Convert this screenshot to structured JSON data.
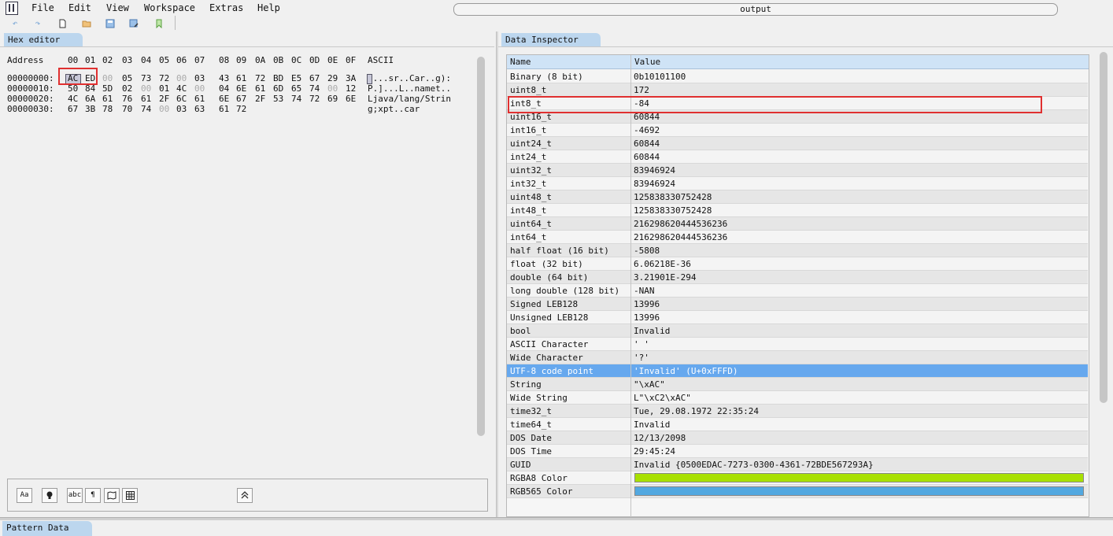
{
  "menu": {
    "items": [
      "File",
      "Edit",
      "View",
      "Workspace",
      "Extras",
      "Help"
    ],
    "output_label": "output"
  },
  "toolbar": {
    "icons": [
      "undo-icon",
      "redo-icon",
      "new-file-icon",
      "open-file-icon",
      "save-icon",
      "save-as-icon",
      "bookmark-icon"
    ]
  },
  "hex_editor": {
    "tab_label": "Hex editor",
    "header": {
      "address": "Address",
      "columns": [
        "00",
        "01",
        "02",
        "03",
        "04",
        "05",
        "06",
        "07",
        "08",
        "09",
        "0A",
        "0B",
        "0C",
        "0D",
        "0E",
        "0F"
      ],
      "ascii": "ASCII"
    },
    "rows": [
      {
        "address": "00000000:",
        "bytes": [
          "AC",
          "ED",
          "00",
          "05",
          "73",
          "72",
          "00",
          "03",
          "43",
          "61",
          "72",
          "BD",
          "E5",
          "67",
          "29",
          "3A"
        ],
        "ascii": " ...sr..Car..g):"
      },
      {
        "address": "00000010:",
        "bytes": [
          "50",
          "84",
          "5D",
          "02",
          "00",
          "01",
          "4C",
          "00",
          "04",
          "6E",
          "61",
          "6D",
          "65",
          "74",
          "00",
          "12"
        ],
        "ascii": "P.]...L..namet.."
      },
      {
        "address": "00000020:",
        "bytes": [
          "4C",
          "6A",
          "61",
          "76",
          "61",
          "2F",
          "6C",
          "61",
          "6E",
          "67",
          "2F",
          "53",
          "74",
          "72",
          "69",
          "6E"
        ],
        "ascii": "Ljava/lang/Strin"
      },
      {
        "address": "00000030:",
        "bytes": [
          "67",
          "3B",
          "78",
          "70",
          "74",
          "00",
          "03",
          "63",
          "61",
          "72"
        ],
        "ascii": "g;xpt..car"
      }
    ],
    "selected_byte": "AC",
    "footer_buttons": [
      "Aa",
      "lightbulb-icon",
      "abc",
      "pilcrow-icon",
      "map-icon",
      "grid-icon",
      "collapse-up-icon"
    ]
  },
  "data_inspector": {
    "tab_label": "Data Inspector",
    "columns": {
      "name": "Name",
      "value": "Value"
    },
    "rows": [
      {
        "name": "Binary (8 bit)",
        "value": "0b10101100"
      },
      {
        "name": "uint8_t",
        "value": "172"
      },
      {
        "name": "int8_t",
        "value": "-84"
      },
      {
        "name": "uint16_t",
        "value": "60844"
      },
      {
        "name": "int16_t",
        "value": "-4692"
      },
      {
        "name": "uint24_t",
        "value": "60844"
      },
      {
        "name": "int24_t",
        "value": "60844"
      },
      {
        "name": "uint32_t",
        "value": "83946924"
      },
      {
        "name": "int32_t",
        "value": "83946924"
      },
      {
        "name": "uint48_t",
        "value": "125838330752428"
      },
      {
        "name": "int48_t",
        "value": "125838330752428"
      },
      {
        "name": "uint64_t",
        "value": "216298620444536236"
      },
      {
        "name": "int64_t",
        "value": "216298620444536236"
      },
      {
        "name": "half float (16 bit)",
        "value": "-5808"
      },
      {
        "name": "float (32 bit)",
        "value": "6.06218E-36"
      },
      {
        "name": "double (64 bit)",
        "value": "3.21901E-294"
      },
      {
        "name": "long double (128 bit)",
        "value": "-NAN"
      },
      {
        "name": "Signed LEB128",
        "value": "13996"
      },
      {
        "name": "Unsigned LEB128",
        "value": "13996"
      },
      {
        "name": "bool",
        "value": "Invalid"
      },
      {
        "name": "ASCII Character",
        "value": "' '"
      },
      {
        "name": "Wide Character",
        "value": "'?'"
      },
      {
        "name": "UTF-8 code point",
        "value": "'Invalid' (U+0xFFFD)"
      },
      {
        "name": "String",
        "value": "\"\\xAC\""
      },
      {
        "name": "Wide String",
        "value": "L\"\\xC2\\xAC\""
      },
      {
        "name": "time32_t",
        "value": "Tue, 29.08.1972 22:35:24"
      },
      {
        "name": "time64_t",
        "value": "Invalid"
      },
      {
        "name": "DOS Date",
        "value": "12/13/2098"
      },
      {
        "name": "DOS Time",
        "value": "29:45:24"
      },
      {
        "name": "GUID",
        "value": "Invalid {0500EDAC-7273-0300-4361-72BDE567293A}"
      },
      {
        "name": "RGBA8 Color",
        "value": ""
      },
      {
        "name": "RGB565 Color",
        "value": ""
      }
    ],
    "selected_row": "UTF-8 code point",
    "rgba8_color": "#a8e000",
    "rgb565_color": "#52a8e0"
  },
  "bottom": {
    "tab_label": "Pattern Data"
  }
}
